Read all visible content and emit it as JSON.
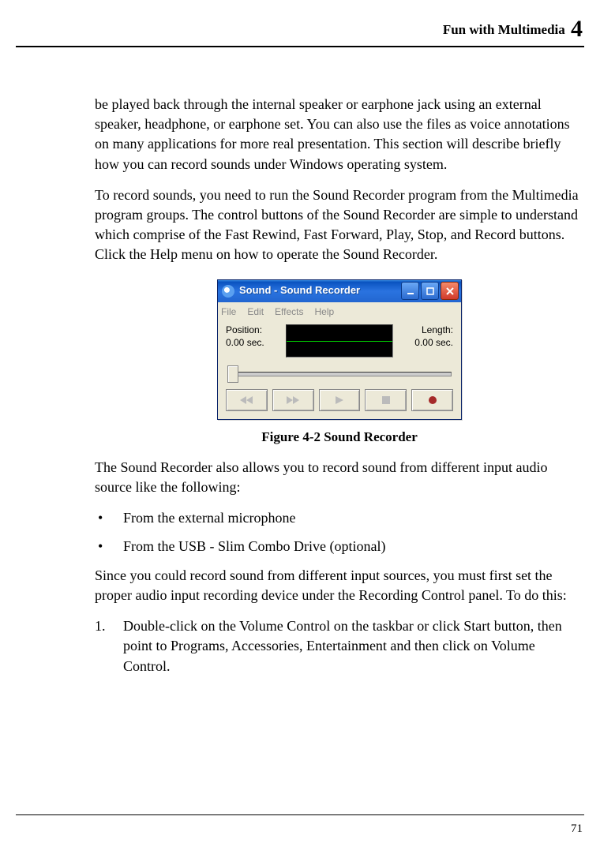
{
  "header": {
    "section_title": "Fun with Multimedia",
    "chapter_number": "4"
  },
  "paragraphs": {
    "p1": "be played back through the internal speaker or earphone jack using an external speaker, headphone, or earphone set. You can also use the files as voice annotations on many applications for more real presentation. This section will describe briefly how you can record sounds under Windows operating system.",
    "p2": "To record sounds, you need to run the Sound Recorder program from the Multimedia program groups. The control buttons of the Sound Recorder are simple to understand which comprise of the Fast Rewind, Fast Forward, Play, Stop, and Record buttons. Click the Help menu on how to operate the Sound Recorder.",
    "p3": "The Sound Recorder also allows you to record sound from different input audio source like the following:",
    "p4": "Since you could record sound from different input sources, you must first set the proper audio input recording device under the Recording Control panel. To do this:"
  },
  "sound_recorder": {
    "title": "Sound - Sound Recorder",
    "menu": {
      "file": "File",
      "edit": "Edit",
      "effects": "Effects",
      "help": "Help"
    },
    "position_label": "Position:",
    "position_value": "0.00 sec.",
    "length_label": "Length:",
    "length_value": "0.00 sec."
  },
  "figure_caption": "Figure 4-2    Sound Recorder",
  "bullets": [
    "From the external microphone",
    "From the USB - Slim Combo Drive (optional)"
  ],
  "steps": [
    "Double-click on the Volume Control on the taskbar or click Start button, then point to Programs, Accessories, Entertainment and then click on Volume Control."
  ],
  "page_number": "71"
}
